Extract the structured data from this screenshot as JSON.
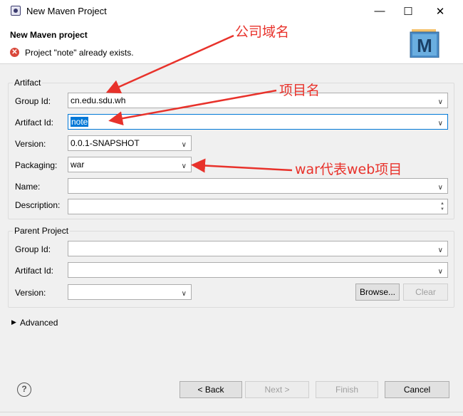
{
  "window": {
    "title": "New Maven Project",
    "minimize": "—",
    "maximize": "☐",
    "close": "✕"
  },
  "header": {
    "title": "New Maven project",
    "error": "Project \"note\" already exists.",
    "logo_letter": "M"
  },
  "artifact": {
    "title": "Artifact",
    "group_id_label": "Group Id:",
    "group_id_value": "cn.edu.sdu.wh",
    "artifact_id_label": "Artifact Id:",
    "artifact_id_value": "note",
    "version_label": "Version:",
    "version_value": "0.0.1-SNAPSHOT",
    "packaging_label": "Packaging:",
    "packaging_value": "war",
    "name_label": "Name:",
    "name_value": "",
    "description_label": "Description:",
    "description_value": ""
  },
  "parent": {
    "title": "Parent Project",
    "group_id_label": "Group Id:",
    "artifact_id_label": "Artifact Id:",
    "version_label": "Version:",
    "browse_label": "Browse...",
    "clear_label": "Clear"
  },
  "advanced": {
    "label": "Advanced"
  },
  "footer": {
    "back": "< Back",
    "next": "Next >",
    "finish": "Finish",
    "cancel": "Cancel"
  },
  "annotations": {
    "company_domain": "公司域名",
    "project_name": "项目名",
    "war_note": "war代表web项目"
  },
  "colors": {
    "annotation": "#e8322b",
    "selection": "#0078d7"
  }
}
